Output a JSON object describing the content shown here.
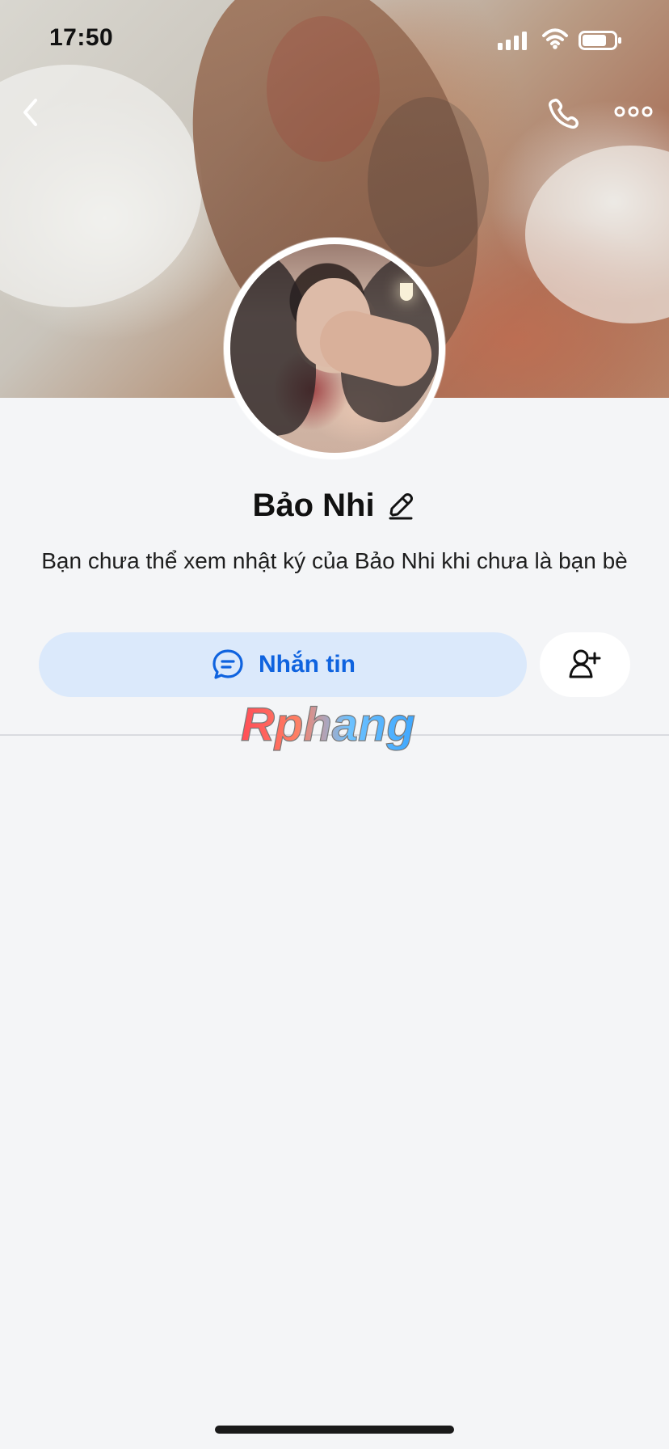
{
  "status_bar": {
    "time": "17:50"
  },
  "header": {
    "back_icon": "chevron-left-icon",
    "call_icon": "phone-icon",
    "more_icon": "more-icon"
  },
  "profile": {
    "name": "Bảo Nhi",
    "edit_icon": "pencil-icon",
    "message": "Bạn chưa thể xem nhật ký của Bảo Nhi khi chưa là bạn bè"
  },
  "actions": {
    "message_button_label": "Nhắn tin",
    "message_icon": "chat-bubble-icon",
    "add_friend_icon": "add-user-icon"
  },
  "watermark": {
    "text": "Rphang"
  },
  "colors": {
    "accent": "#0f63df",
    "button_bg": "#dbe9fb",
    "page_bg": "#f4f5f7"
  }
}
